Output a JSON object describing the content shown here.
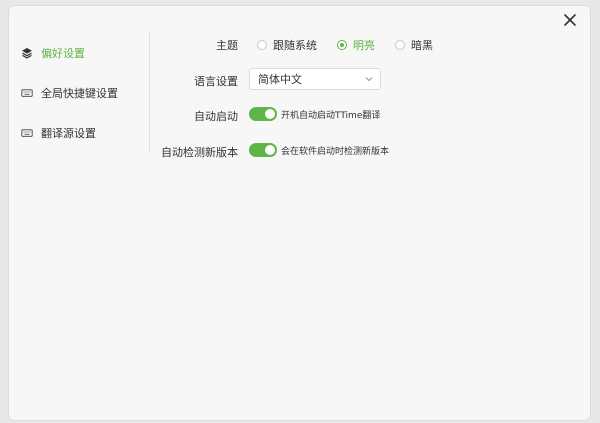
{
  "window": {
    "close_glyph": "×"
  },
  "sidebar": {
    "items": [
      {
        "label": "偏好设置",
        "icon": "layers-icon",
        "active": true
      },
      {
        "label": "全局快捷键设置",
        "icon": "keyboard-icon",
        "active": false
      },
      {
        "label": "翻译源设置",
        "icon": "keyboard-icon",
        "active": false
      }
    ]
  },
  "settings": {
    "theme": {
      "label": "主题",
      "options": [
        {
          "label": "跟随系统",
          "checked": false
        },
        {
          "label": "明亮",
          "checked": true
        },
        {
          "label": "暗黑",
          "checked": false
        }
      ]
    },
    "language": {
      "label": "语言设置",
      "value": "简体中文"
    },
    "autostart": {
      "label": "自动启动",
      "on": true,
      "description": "开机自动启动TTime翻译"
    },
    "update_check": {
      "label": "自动检测新版本",
      "on": true,
      "description": "会在软件启动时检测新版本"
    }
  },
  "colors": {
    "accent": "#5fb547",
    "text": "#333333"
  }
}
